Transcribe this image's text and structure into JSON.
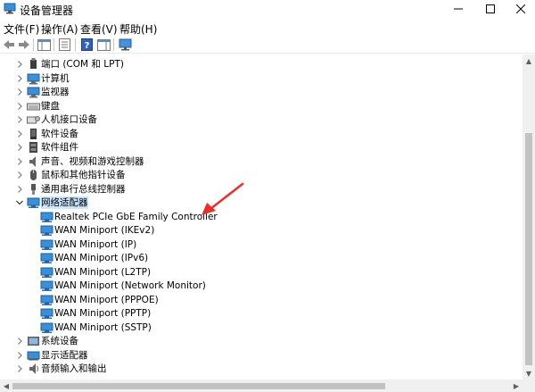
{
  "window": {
    "title": "设备管理器"
  },
  "menu": [
    {
      "label": "文件(F)"
    },
    {
      "label": "操作(A)"
    },
    {
      "label": "查看(V)"
    },
    {
      "label": "帮助(H)"
    }
  ],
  "tree": {
    "rows": [
      {
        "label": "端口 (COM 和 LPT)",
        "icon": "port-icon",
        "expanded": false,
        "level": 0
      },
      {
        "label": "计算机",
        "icon": "computer-icon",
        "expanded": false,
        "level": 0
      },
      {
        "label": "监视器",
        "icon": "monitor-icon",
        "expanded": false,
        "level": 0
      },
      {
        "label": "键盘",
        "icon": "keyboard-icon",
        "expanded": false,
        "level": 0
      },
      {
        "label": "人机接口设备",
        "icon": "hid-icon",
        "expanded": false,
        "level": 0
      },
      {
        "label": "软件设备",
        "icon": "software-device-icon",
        "expanded": false,
        "level": 0
      },
      {
        "label": "软件组件",
        "icon": "software-component-icon",
        "expanded": false,
        "level": 0
      },
      {
        "label": "声音、视频和游戏控制器",
        "icon": "audio-icon",
        "expanded": false,
        "level": 0
      },
      {
        "label": "鼠标和其他指针设备",
        "icon": "mouse-icon",
        "expanded": false,
        "level": 0
      },
      {
        "label": "通用串行总线控制器",
        "icon": "usb-icon",
        "expanded": false,
        "level": 0
      },
      {
        "label": "网络适配器",
        "icon": "network-adapter-icon",
        "expanded": true,
        "level": 0,
        "selected": true
      },
      {
        "label": "Realtek PCIe GbE Family Controller",
        "icon": "network-adapter-icon",
        "level": 1
      },
      {
        "label": "WAN Miniport (IKEv2)",
        "icon": "network-adapter-icon",
        "level": 1
      },
      {
        "label": "WAN Miniport (IP)",
        "icon": "network-adapter-icon",
        "level": 1
      },
      {
        "label": "WAN Miniport (IPv6)",
        "icon": "network-adapter-icon",
        "level": 1
      },
      {
        "label": "WAN Miniport (L2TP)",
        "icon": "network-adapter-icon",
        "level": 1
      },
      {
        "label": "WAN Miniport (Network Monitor)",
        "icon": "network-adapter-icon",
        "level": 1
      },
      {
        "label": "WAN Miniport (PPPOE)",
        "icon": "network-adapter-icon",
        "level": 1
      },
      {
        "label": "WAN Miniport (PPTP)",
        "icon": "network-adapter-icon",
        "level": 1
      },
      {
        "label": "WAN Miniport (SSTP)",
        "icon": "network-adapter-icon",
        "level": 1
      },
      {
        "label": "系统设备",
        "icon": "system-device-icon",
        "expanded": false,
        "level": 0
      },
      {
        "label": "显示适配器",
        "icon": "display-adapter-icon",
        "expanded": false,
        "level": 0
      },
      {
        "label": "音频输入和输出",
        "icon": "speaker-icon",
        "expanded": false,
        "level": 0
      }
    ]
  },
  "colors": {
    "annotation_arrow": "#e8312a",
    "selection": "#cce8ff",
    "icon_blue": "#2b7fd0"
  }
}
